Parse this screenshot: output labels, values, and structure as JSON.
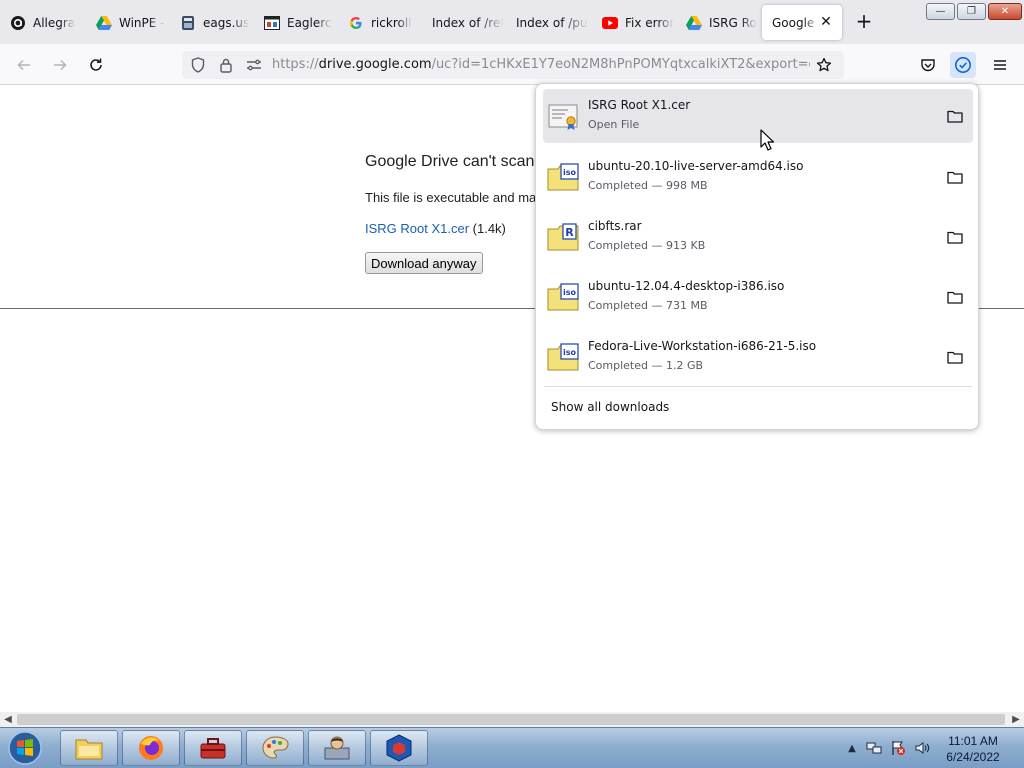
{
  "tabs": [
    {
      "title": "Allegra",
      "icon": "allegra-icon",
      "active": false
    },
    {
      "title": "WinPE -",
      "icon": "google-drive-icon",
      "active": false
    },
    {
      "title": "eags.us",
      "icon": "eags-icon",
      "active": false
    },
    {
      "title": "Eaglerc",
      "icon": "eaglercraft-icon",
      "active": false
    },
    {
      "title": "rickroll",
      "icon": "google-icon",
      "active": false
    },
    {
      "title": "Index of /rel",
      "icon": "",
      "active": false
    },
    {
      "title": "Index of /pu",
      "icon": "",
      "active": false
    },
    {
      "title": "Fix error",
      "icon": "youtube-icon",
      "active": false
    },
    {
      "title": "ISRG Ro",
      "icon": "google-drive-icon",
      "active": false
    },
    {
      "title": "Google D",
      "icon": "",
      "active": true
    }
  ],
  "new_tab_label": "+",
  "window_controls": {
    "minimize": "—",
    "maximize": "❐",
    "close": "✕"
  },
  "address_bar": {
    "url_prefix": "https://",
    "url_host": "drive.google.com",
    "url_path": "/uc?id=1cHKxE1Y7eoN2M8hPnPOMYqtxcalkiXT2&export=dow"
  },
  "page": {
    "title": "Google Drive can't scan",
    "message": "This file is executable and ma",
    "file_link": "ISRG Root X1.cer",
    "file_size": " (1.4k)",
    "download_button": "Download anyway"
  },
  "downloads": {
    "items": [
      {
        "name": "ISRG Root X1.cer",
        "status": "Open File",
        "icon": "certificate-file-icon",
        "badge": "",
        "hover": true
      },
      {
        "name": "ubuntu-20.10-live-server-amd64.iso",
        "status": "Completed — 998 MB",
        "icon": "iso-file-icon",
        "badge": "iso",
        "hover": false
      },
      {
        "name": "cibfts.rar",
        "status": "Completed — 913 KB",
        "icon": "rar-file-icon",
        "badge": "R",
        "hover": false
      },
      {
        "name": "ubuntu-12.04.4-desktop-i386.iso",
        "status": "Completed — 731 MB",
        "icon": "iso-file-icon",
        "badge": "iso",
        "hover": false
      },
      {
        "name": "Fedora-Live-Workstation-i686-21-5.iso",
        "status": "Completed — 1.2 GB",
        "icon": "iso-file-icon",
        "badge": "iso",
        "hover": false
      }
    ],
    "show_all": "Show all downloads"
  },
  "taskbar": {
    "apps": [
      "file-explorer",
      "firefox",
      "toolbox",
      "paint",
      "user-manager",
      "virtualbox"
    ],
    "time": "11:01 AM",
    "date": "6/24/2022"
  },
  "colors": {
    "accent": "#0061e0",
    "link": "#1a5fb4",
    "tabstrip": "#e8e8ed",
    "taskbar": "#8eaed0"
  }
}
